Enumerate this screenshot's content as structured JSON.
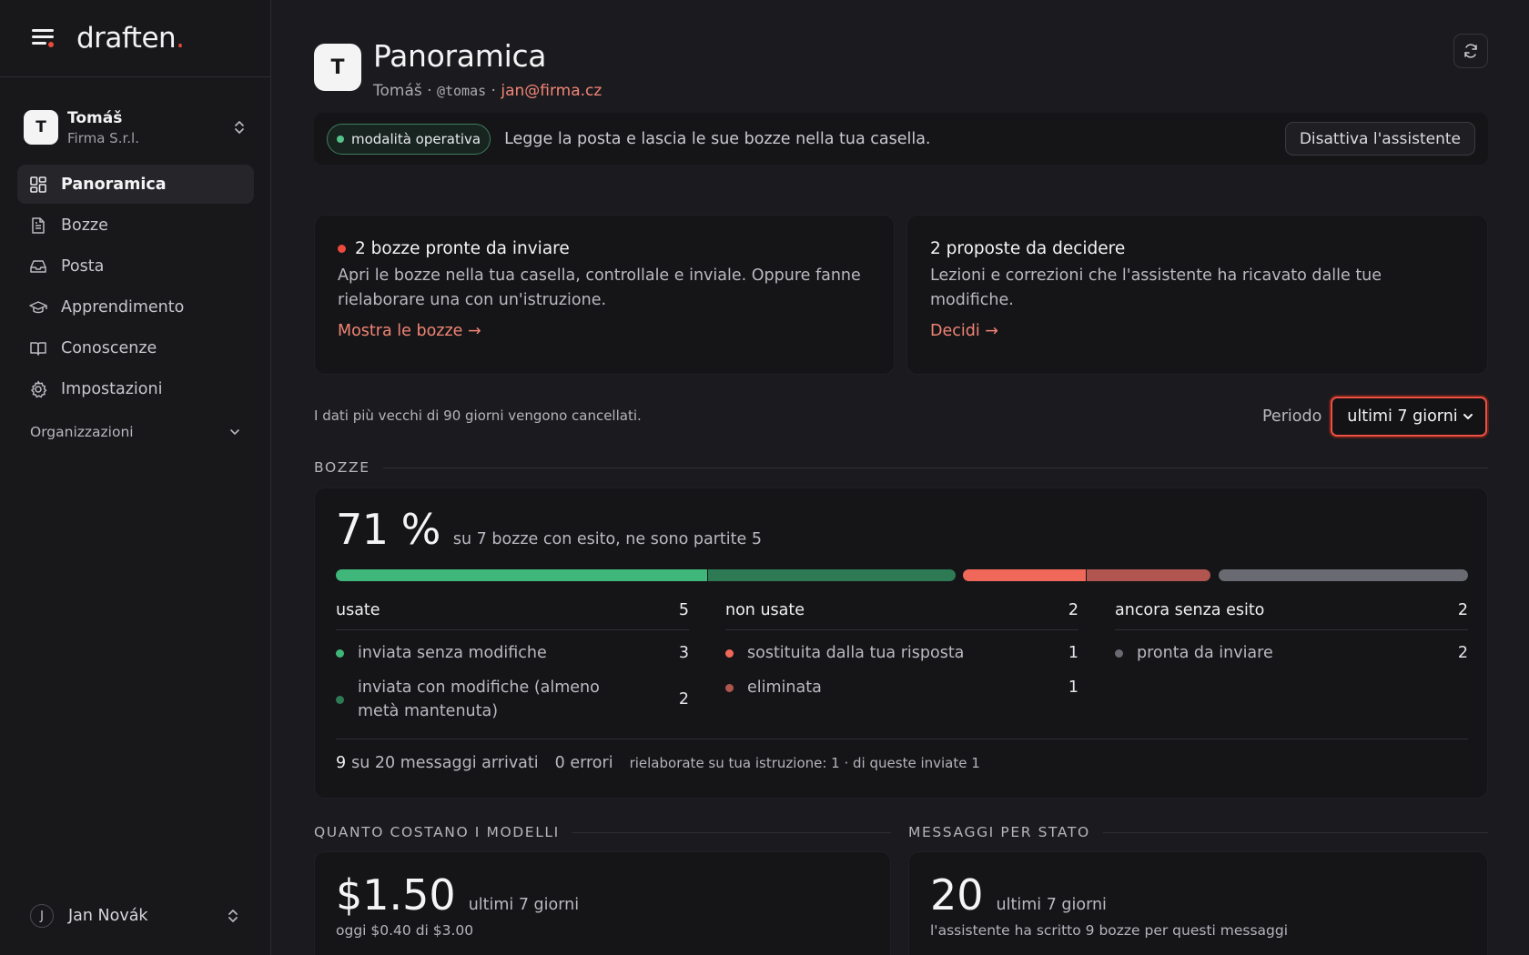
{
  "brand": {
    "name": "draften",
    "dot": "."
  },
  "org": {
    "avatar": "T",
    "name": "Tomáš",
    "company": "Firma S.r.l."
  },
  "nav": [
    {
      "label": "Panoramica",
      "icon": "dashboard-icon",
      "active": true
    },
    {
      "label": "Bozze",
      "icon": "document-icon"
    },
    {
      "label": "Posta",
      "icon": "inbox-icon"
    },
    {
      "label": "Apprendimento",
      "icon": "graduation-cap-icon"
    },
    {
      "label": "Conoscenze",
      "icon": "book-icon"
    },
    {
      "label": "Impostazioni",
      "icon": "gear-icon"
    }
  ],
  "organizations_label": "Organizzazioni",
  "user": {
    "avatar": "J",
    "name": "Jan Novák"
  },
  "header": {
    "avatar": "T",
    "title": "Panoramica",
    "name": "Tomáš",
    "sep1": " · ",
    "handle": "@tomas",
    "sep2": " · ",
    "email": "jan@firma.cz"
  },
  "mode": {
    "pill": "modalità operativa",
    "description": "Legge la posta e lascia le sue bozze nella tua casella.",
    "button": "Disattiva l'assistente"
  },
  "drafts_card": {
    "title": "2 bozze pronte da inviare",
    "text": "Apri le bozze nella tua casella, controllale e inviale. Oppure fanne rielaborare una con un'istruzione.",
    "link": "Mostra le bozze →"
  },
  "proposals_card": {
    "title": "2 proposte da decidere",
    "text": "Lezioni e correzioni che l'assistente ha ricavato dalle tue modifiche.",
    "link": "Decidi →"
  },
  "retention_note": "I dati più vecchi di 90 giorni vengono cancellati.",
  "period": {
    "label": "Periodo",
    "selected": "ultimi 7 giorni"
  },
  "bozze": {
    "section": "BOZZE",
    "percent": "71 %",
    "summary": "su 7 bozze con esito, ne sono partite 5",
    "colors": {
      "sent_unchanged": "#3fb67a",
      "sent_modified": "#2d7a55",
      "replaced": "#f0685a",
      "deleted": "#b05550",
      "pending": "#6a6a73"
    },
    "columns": [
      {
        "title": "usate",
        "count": "5",
        "rows": [
          {
            "label": "inviata senza modifiche",
            "count": "3",
            "color": "#3fb67a"
          },
          {
            "label": "inviata con modifiche (almeno metà mantenuta)",
            "count": "2",
            "color": "#2d7a55"
          }
        ]
      },
      {
        "title": "non usate",
        "count": "2",
        "rows": [
          {
            "label": "sostituita dalla tua risposta",
            "count": "1",
            "color": "#f0685a"
          },
          {
            "label": "eliminata",
            "count": "1",
            "color": "#b05550"
          }
        ]
      },
      {
        "title": "ancora senza esito",
        "count": "2",
        "rows": [
          {
            "label": "pronta da inviare",
            "count": "2",
            "color": "#6a6a73"
          }
        ]
      }
    ],
    "footer": {
      "arrived_count": "9",
      "arrived_text": "su 20 messaggi arrivati",
      "errors": "0 errori",
      "reworked": "rielaborate su tua istruzione: 1 · di queste inviate 1"
    }
  },
  "costs": {
    "section": "QUANTO COSTANO I MODELLI",
    "value": "$1.50",
    "period": "ultimi 7 giorni",
    "sub": "oggi $0.40 di $3.00"
  },
  "messages": {
    "section": "MESSAGGI PER STATO",
    "value": "20",
    "period": "ultimi 7 giorni",
    "sub": "l'assistente ha scritto 9 bozze per questi messaggi"
  }
}
